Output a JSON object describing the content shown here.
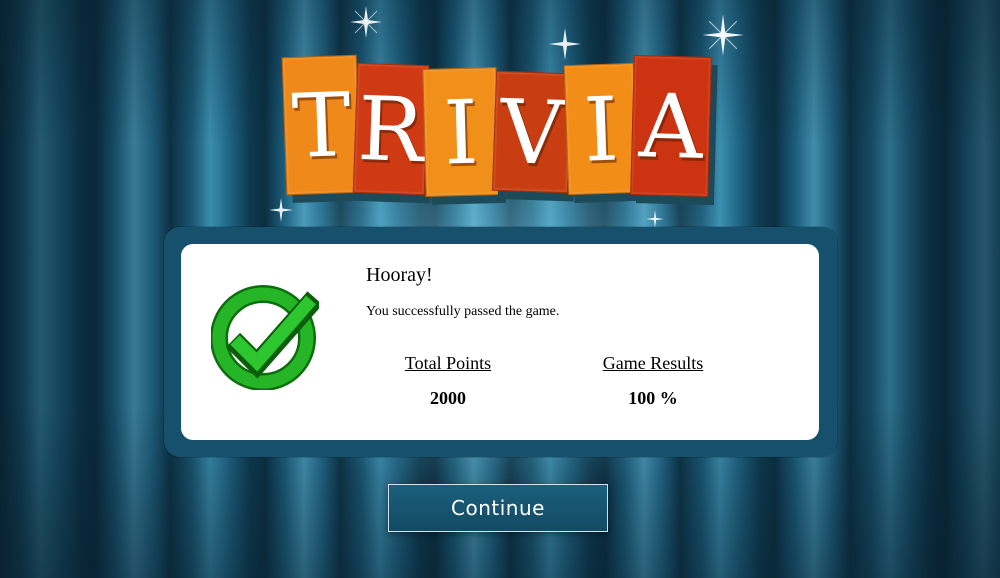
{
  "title": {
    "letters": [
      "T",
      "R",
      "I",
      "V",
      "I",
      "A"
    ]
  },
  "dialog": {
    "heading": "Hooray!",
    "message": "You successfully passed the game.",
    "stats": [
      {
        "label": "Total Points",
        "value": "2000"
      },
      {
        "label": "Game Results",
        "value": "100 %"
      }
    ],
    "icon": "checkmark-icon"
  },
  "continue_label": "Continue",
  "colors": {
    "tile_orange": "#ef8a1a",
    "tile_red": "#cf3a14",
    "frame": "#16506c",
    "check_green": "#1aa31a"
  }
}
